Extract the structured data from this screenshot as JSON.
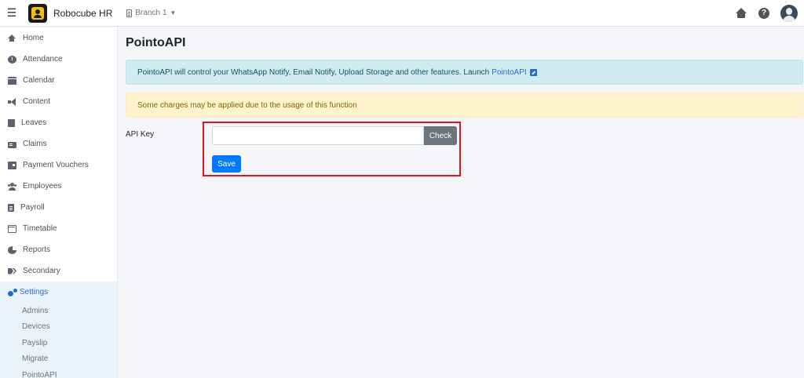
{
  "header": {
    "app_title": "Robocube HR",
    "branch_label": "Branch 1"
  },
  "sidebar": {
    "items": [
      {
        "label": "Home",
        "icon": "home-icon"
      },
      {
        "label": "Attendance",
        "icon": "clock-icon"
      },
      {
        "label": "Calendar",
        "icon": "calendar-icon"
      },
      {
        "label": "Content",
        "icon": "bullhorn-icon"
      },
      {
        "label": "Leaves",
        "icon": "door-icon"
      },
      {
        "label": "Claims",
        "icon": "id-card-icon"
      },
      {
        "label": "Payment Vouchers",
        "icon": "voucher-icon"
      },
      {
        "label": "Employees",
        "icon": "users-icon"
      },
      {
        "label": "Payroll",
        "icon": "file-icon"
      },
      {
        "label": "Timetable",
        "icon": "calendar-outline-icon"
      },
      {
        "label": "Reports",
        "icon": "pie-chart-icon"
      },
      {
        "label": "Secondary",
        "icon": "tags-icon"
      },
      {
        "label": "Settings",
        "icon": "cogs-icon"
      }
    ],
    "active_item": "Settings",
    "sub_items": [
      "Admins",
      "Devices",
      "Payslip",
      "Migrate",
      "PointoAPI"
    ]
  },
  "main": {
    "page_title": "PointoAPI",
    "info_text": "PointoAPI will control your WhatsApp Notify, Email Notify, Upload Storage and other features. Launch",
    "info_link": "PointoAPI",
    "warning_text": "Some charges may be applied due to the usage of this function",
    "api_key_label": "API Key",
    "api_key_value": "",
    "check_label": "Check",
    "save_label": "Save"
  },
  "colors": {
    "accent": "#007bff",
    "highlight_border": "#e0141e",
    "info_bg": "#d1ecf1",
    "warning_bg": "#fff3cd",
    "active_nav": "#1f6fd1"
  }
}
